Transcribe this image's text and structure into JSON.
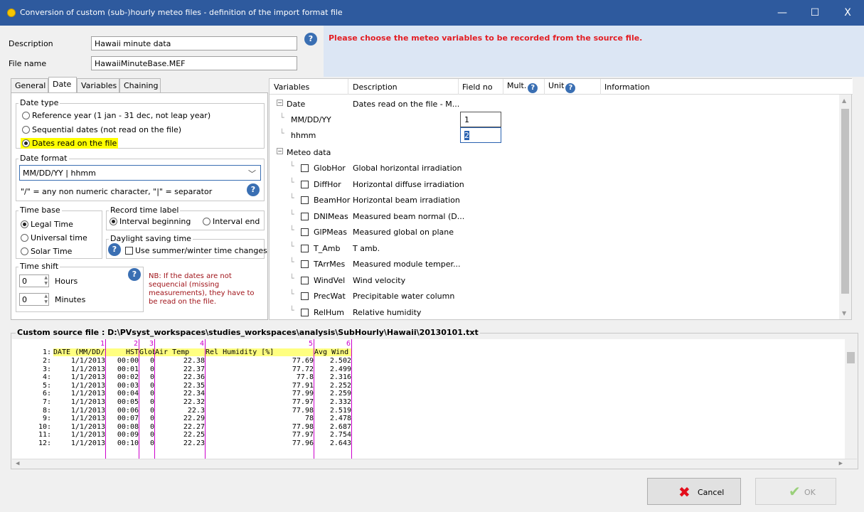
{
  "window": {
    "title": "Conversion of custom (sub-)hourly meteo files - definition of the import format file",
    "minimize_glyph": "—",
    "maximize_glyph": "☐",
    "close_glyph": "X"
  },
  "header": {
    "description_label": "Description",
    "description_value": "Hawaii minute data",
    "filename_label": "File name",
    "filename_value": "HawaiiMinuteBase.MEF",
    "notice": "Please choose the meteo variables to be recorded from the source file."
  },
  "tabs": [
    {
      "label": "General"
    },
    {
      "label": "Date"
    },
    {
      "label": "Variables"
    },
    {
      "label": "Chaining"
    }
  ],
  "date_tab": {
    "date_type_title": "Date type",
    "date_type_options": [
      "Reference year (1 jan - 31 dec, not leap year)",
      "Sequential dates (not read on the file)",
      "Dates read on the file"
    ],
    "date_format_title": "Date format",
    "date_format_value": "MM/DD/YY | hhmm",
    "date_format_hint": "\"/\" = any non numeric character, \"|\" = separator",
    "time_base_title": "Time base",
    "time_base_options": [
      "Legal Time",
      "Universal time",
      "Solar Time"
    ],
    "record_label_title": "Record time label",
    "record_label_options": [
      "Interval beginning",
      "Interval end"
    ],
    "dst_title": "Daylight saving time",
    "dst_checkbox": "Use summer/winter time changes",
    "time_shift_title": "Time shift",
    "hours_value": "0",
    "hours_label": "Hours",
    "minutes_value": "0",
    "minutes_label": "Minutes",
    "nb_text": "NB: If the dates are not sequencial (missing measurements), they have to be read on the file."
  },
  "variables": {
    "headers": {
      "variables": "Variables",
      "description": "Description",
      "field_no": "Field no",
      "mult": "Mult.",
      "unit": "Unit",
      "information": "Information"
    },
    "date_group": {
      "name": "Date",
      "description": "Dates read on the file - M..."
    },
    "date_fields": [
      {
        "name": "MM/DD/YY",
        "field": "1"
      },
      {
        "name": "hhmm",
        "field": "2"
      }
    ],
    "meteo_group": {
      "name": "Meteo data"
    },
    "meteo_items": [
      {
        "name": "GlobHor",
        "description": "Global horizontal irradiation"
      },
      {
        "name": "DiffHor",
        "description": "Horizontal diffuse irradiation"
      },
      {
        "name": "BeamHor",
        "description": "Horizontal beam irradiation"
      },
      {
        "name": "DNIMeas",
        "description": "Measured beam normal (D..."
      },
      {
        "name": "GlPMeas",
        "description": "Measured global on plane"
      },
      {
        "name": "T_Amb",
        "description": "T amb."
      },
      {
        "name": "TArrMes",
        "description": "Measured module temper..."
      },
      {
        "name": "WindVel",
        "description": "Wind velocity"
      },
      {
        "name": "PrecWat",
        "description": "Precipitable water column"
      },
      {
        "name": "RelHum",
        "description": "Relative humidity"
      }
    ]
  },
  "source_file": {
    "title": "Custom source file : D:\\PVsyst_workspaces\\studies_workspaces\\analysis\\SubHourly\\Hawaii\\20130101.txt",
    "column_numbers": [
      "1",
      "2",
      "3",
      "4",
      "5",
      "6"
    ],
    "header_row": {
      "line": "1:",
      "cells": [
        "DATE (MM/DD/YYYY)",
        "HST",
        "Global H",
        "Air Temp",
        "Rel Humidity [%]",
        "Avg Wind"
      ]
    },
    "rows": [
      {
        "line": "2:",
        "cells": [
          "1/1/2013",
          "00:00",
          "0",
          "22.38",
          "77.69",
          "2.502"
        ]
      },
      {
        "line": "3:",
        "cells": [
          "1/1/2013",
          "00:01",
          "0",
          "22.37",
          "77.72",
          "2.499"
        ]
      },
      {
        "line": "4:",
        "cells": [
          "1/1/2013",
          "00:02",
          "0",
          "22.36",
          "77.8",
          "2.316"
        ]
      },
      {
        "line": "5:",
        "cells": [
          "1/1/2013",
          "00:03",
          "0",
          "22.35",
          "77.91",
          "2.252"
        ]
      },
      {
        "line": "6:",
        "cells": [
          "1/1/2013",
          "00:04",
          "0",
          "22.34",
          "77.99",
          "2.259"
        ]
      },
      {
        "line": "7:",
        "cells": [
          "1/1/2013",
          "00:05",
          "0",
          "22.32",
          "77.97",
          "2.332"
        ]
      },
      {
        "line": "8:",
        "cells": [
          "1/1/2013",
          "00:06",
          "0",
          "22.3",
          "77.98",
          "2.519"
        ]
      },
      {
        "line": "9:",
        "cells": [
          "1/1/2013",
          "00:07",
          "0",
          "22.29",
          "78",
          "2.478"
        ]
      },
      {
        "line": "10:",
        "cells": [
          "1/1/2013",
          "00:08",
          "0",
          "22.27",
          "77.98",
          "2.687"
        ]
      },
      {
        "line": "11:",
        "cells": [
          "1/1/2013",
          "00:09",
          "0",
          "22.25",
          "77.97",
          "2.754"
        ]
      },
      {
        "line": "12:",
        "cells": [
          "1/1/2013",
          "00:10",
          "0",
          "22.23",
          "77.96",
          "2.643"
        ]
      }
    ]
  },
  "buttons": {
    "cancel": "Cancel",
    "ok": "OK"
  },
  "colors": {
    "titlebar": "#2e5a9e",
    "notice_text": "#e31e24",
    "notice_panel": "#dce6f4",
    "column_separator": "#cc00cc",
    "highlight": "#ffff00"
  }
}
